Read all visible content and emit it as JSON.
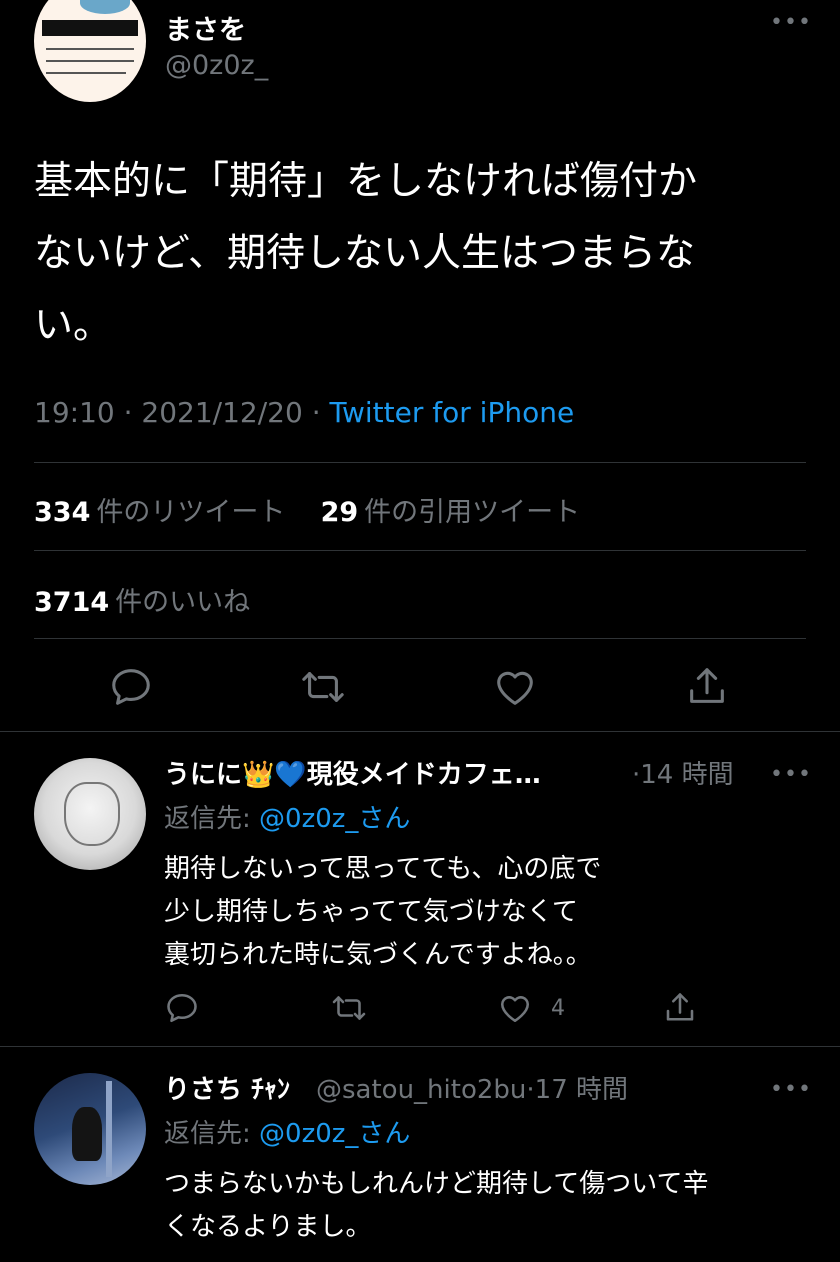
{
  "main_tweet": {
    "display_name": "まさを",
    "handle": "@0z0z_",
    "text_lines": [
      "基本的に「期待」をしなければ傷付か",
      "ないけど、期待しない人生はつまらな",
      "い。"
    ],
    "time": "19:10",
    "date": "2021/12/20",
    "source": "Twitter for iPhone",
    "retweets": {
      "count": "334",
      "label": "件のリツイート"
    },
    "quotes": {
      "count": "29",
      "label": "件の引用ツイート"
    },
    "likes": {
      "count": "3714",
      "label": "件のいいね"
    },
    "more_icon": "more-dots-icon"
  },
  "actions": {
    "reply_icon": "reply-icon",
    "retweet_icon": "retweet-icon",
    "like_icon": "like-icon",
    "share_icon": "share-icon"
  },
  "replies": [
    {
      "display_name": "うにに👑💙現役メイドカフェ…",
      "time": "14 時間",
      "reply_to_prefix": "返信先: ",
      "reply_to_handle": "@0z0z_さん",
      "text_lines": [
        "期待しないって思ってても、心の底で",
        "少し期待しちゃってて気づけなくて",
        "裏切られた時に気づくんですよね。。"
      ],
      "like_count": "4"
    },
    {
      "display_name": "りさち ﾁｬﾝ",
      "handle": "@satou_hito2bu",
      "time": "17 時間",
      "reply_to_prefix": "返信先: ",
      "reply_to_handle": "@0z0z_さん",
      "text_lines": [
        "つまらないかもしれんけど期待して傷ついて辛",
        "くなるよりまし。"
      ]
    }
  ],
  "colors": {
    "background": "#000000",
    "text": "#e7e9ea",
    "muted": "#71767b",
    "link": "#1d9bf0",
    "divider": "#2f3336"
  }
}
